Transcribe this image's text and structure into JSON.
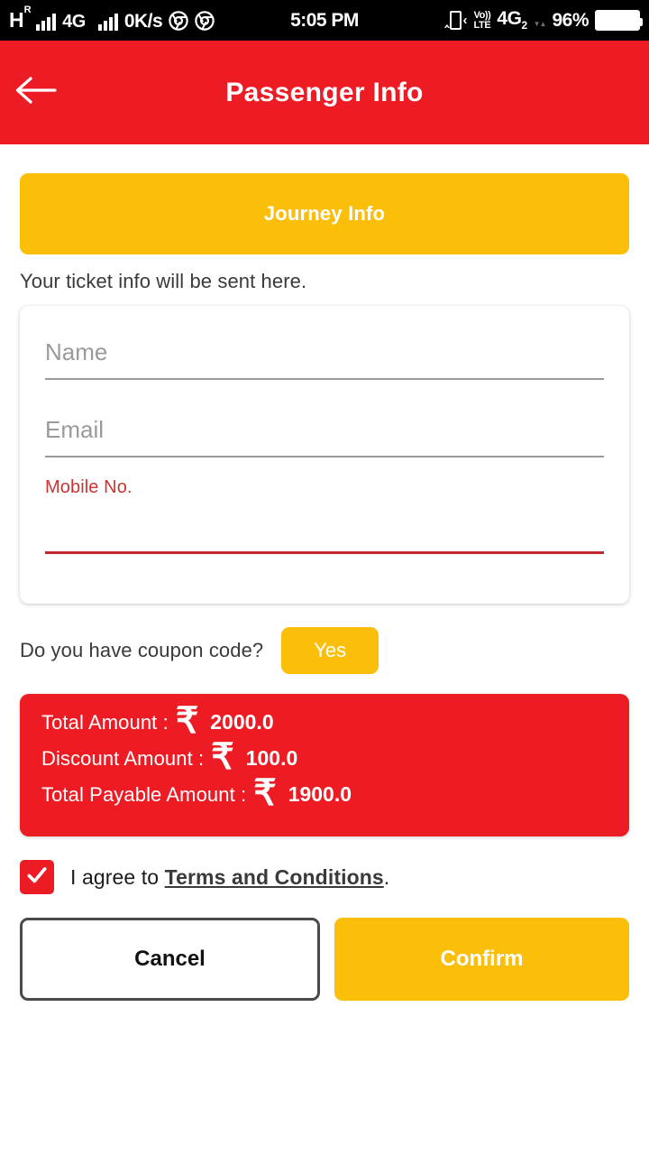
{
  "statusbar": {
    "network_type": "H",
    "roaming": "R",
    "network_4g": "4G",
    "data_speed": "0K/s",
    "app_icon_1": "chrome-icon",
    "app_icon_2": "chrome-icon",
    "time": "5:05 PM",
    "vibrate_icon": "vibrate-icon",
    "volte_top": "Vo))",
    "volte_bottom": "LTE",
    "sim_network": "4G",
    "sim_index": "2",
    "battery_percent": "96%",
    "battery_icon": "battery-full-icon"
  },
  "header": {
    "back_icon": "arrow-left-icon",
    "title": "Passenger Info",
    "background_color": "#ED1C24"
  },
  "main": {
    "journey_button": "Journey Info",
    "hint": "Your ticket info will be sent here.",
    "form": {
      "name": {
        "value": "",
        "placeholder": "Name"
      },
      "email": {
        "value": "",
        "placeholder": "Email"
      },
      "mobile": {
        "label": "Mobile No.",
        "value": "",
        "placeholder": ""
      }
    },
    "coupon": {
      "question": "Do you have coupon code?",
      "yes_label": "Yes"
    },
    "summary": {
      "currency": "₹",
      "rows": [
        {
          "label": "Total Amount :",
          "value": "2000.0"
        },
        {
          "label": "Discount Amount :",
          "value": "100.0"
        },
        {
          "label": "Total Payable Amount :",
          "value": "1900.0"
        }
      ]
    },
    "terms": {
      "checked": true,
      "check_icon": "check-icon",
      "prefix": "I agree to ",
      "link": "Terms and Conditions",
      "suffix": "."
    },
    "actions": {
      "cancel": "Cancel",
      "confirm": "Confirm"
    }
  },
  "colors": {
    "brand_red": "#ED1C24",
    "brand_yellow": "#FBBF09",
    "error_red": "#C1272D"
  }
}
